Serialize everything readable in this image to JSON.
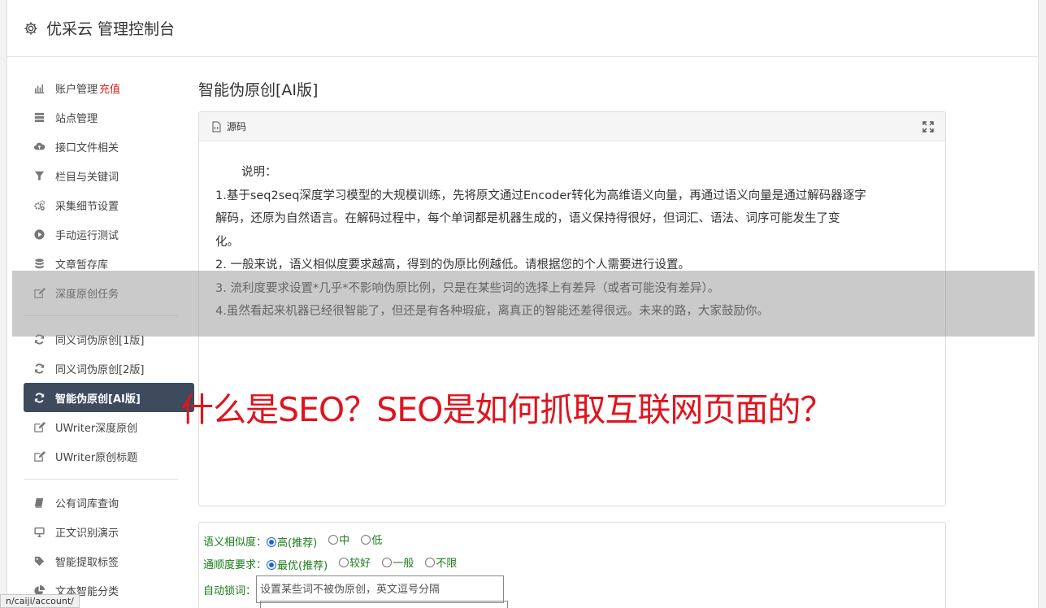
{
  "header": {
    "title": "优采云 管理控制台"
  },
  "sidebar": {
    "recharge": "充值",
    "group1": [
      {
        "label": "账户管理",
        "icon": "bar-chart-icon"
      },
      {
        "label": "站点管理",
        "icon": "server-icon"
      },
      {
        "label": "接口文件相关",
        "icon": "cloud-upload-icon"
      },
      {
        "label": "栏目与关键词",
        "icon": "filter-icon"
      },
      {
        "label": "采集细节设置",
        "icon": "gears-icon"
      },
      {
        "label": "手动运行测试",
        "icon": "play-icon"
      },
      {
        "label": "文章暂存库",
        "icon": "database-icon"
      },
      {
        "label": "深度原创任务",
        "icon": "edit-icon"
      }
    ],
    "group2": [
      {
        "label": "同义词伪原创[1版]",
        "icon": "refresh-icon"
      },
      {
        "label": "同义词伪原创[2版]",
        "icon": "refresh-icon"
      },
      {
        "label": "智能伪原创[AI版]",
        "icon": "refresh-icon",
        "active": true
      },
      {
        "label": "UWriter深度原创",
        "icon": "edit-icon"
      },
      {
        "label": "UWriter原创标题",
        "icon": "edit-icon"
      }
    ],
    "group3": [
      {
        "label": "公有词库查询",
        "icon": "book-icon"
      },
      {
        "label": "正文识别演示",
        "icon": "monitor-icon"
      },
      {
        "label": "智能提取标签",
        "icon": "tag-icon"
      },
      {
        "label": "文本智能分类",
        "icon": "pie-chart-icon"
      }
    ]
  },
  "main": {
    "title": "智能伪原创[AI版]",
    "editor": {
      "source_label": "源码",
      "intro": "说明：",
      "lines": [
        "1.基于seq2seq深度学习模型的大规模训练，先将原文通过Encoder转化为高维语义向量，再通过语义向量是通过解码器逐字",
        "解码，还原为自然语言。在解码过程中，每个单词都是机器生成的，语义保持得很好，但词汇、语法、词序可能发生了变",
        "化。",
        "2. 一般来说，语义相似度要求越高，得到的伪原比例越低。请根据您的个人需要进行设置。",
        "3. 流利度要求设置*几乎*不影响伪原比例，只是在某些词的选择上有差异（或者可能没有差异）。",
        "4.虽然看起来机器已经很智能了，但还是有各种瑕疵，离真正的智能还差得很远。未来的路，大家鼓励你。"
      ]
    },
    "settings": {
      "similarity_label": "语义相似度：",
      "similarity_options": [
        "高(推荐)",
        "中",
        "低"
      ],
      "fluency_label": "通顺度要求：",
      "fluency_options": [
        "最优(推荐)",
        "较好",
        "一般",
        "不限"
      ],
      "lock_label": "自动锁词：",
      "lock_placeholder": "设置某些词不被伪原创，英文逗号分隔"
    }
  },
  "overlay": {
    "headline": "什么是SEO？SEO是如何抓取互联网页面的？"
  },
  "status_url": "n/caiji/account/"
}
